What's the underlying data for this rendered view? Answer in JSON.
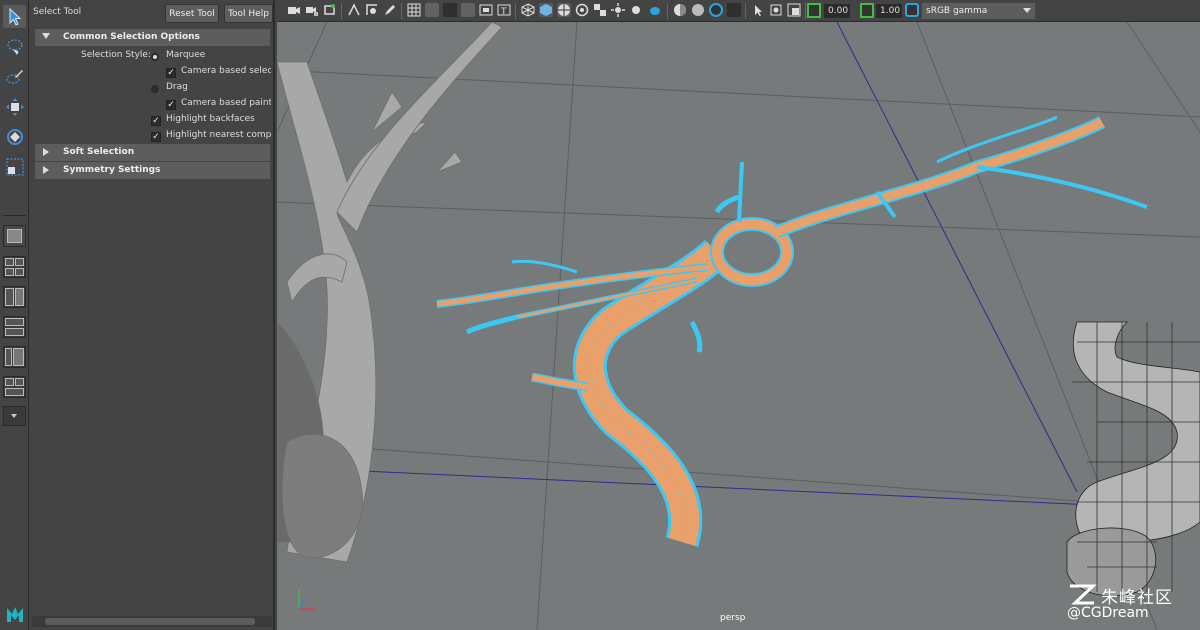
{
  "tool_settings": {
    "title": "Select Tool",
    "reset_button": "Reset Tool",
    "help_button": "Tool Help",
    "sections": {
      "common": "Common Selection Options",
      "soft": "Soft Selection",
      "symmetry": "Symmetry Settings"
    },
    "selection_style_label": "Selection Style:",
    "marquee_label": "Marquee",
    "camera_based_selection": "Camera based selecti",
    "drag_label": "Drag",
    "camera_based_paint": "Camera based paint s",
    "highlight_backfaces": "Highlight backfaces",
    "highlight_nearest": "Highlight nearest compo",
    "checkmark": "✓"
  },
  "viewport": {
    "exposure_value": "0.00",
    "gamma_value": "1.00",
    "color_space": "sRGB gamma",
    "camera_label": "persp"
  },
  "watermark": {
    "line1": "朱峰社区",
    "line2": "@CGDream"
  },
  "colors": {
    "panel_bg": "#444444",
    "viewport_bg": "#777a7b",
    "wire_orange": "#e9a06a",
    "wire_cyan": "#3cc8f4",
    "grid_blue": "#2b2f8c",
    "accent_green": "#3fbf3f",
    "accent_blue": "#2aa3df"
  }
}
